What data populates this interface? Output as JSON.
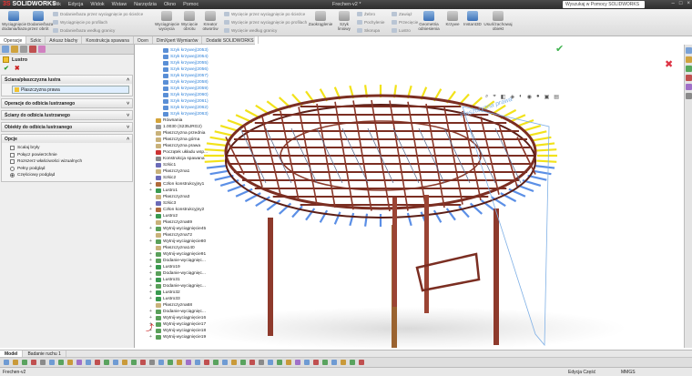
{
  "app": {
    "logo_prefix": "3S",
    "logo_name": "SOLIDWORKS",
    "menu": [
      "Plik",
      "Edycja",
      "Widok",
      "Wstaw",
      "Narzędzia",
      "Okno",
      "Pomoc"
    ],
    "document_title": "Frechen-v2 *",
    "search_placeholder": "Wyszukaj w Pomocy SOLIDWORKS"
  },
  "command_manager": {
    "extrude_boss": "Wyciągnięcie dodania/baza",
    "revolve_boss": "Dodanie/baza przez obrót",
    "sweep_boss": "Dodanie/baza przez wyciągnięcie po ścieżce",
    "loft_boss": "Wyciągnięcie po profilach",
    "boundary_boss": "Dodanie/baza według granicy",
    "extrude_cut": "Wyciągnięcie wycięcia",
    "revolve_cut": "Wycięcie obrotu",
    "hole_wizard": "Kreator otworów",
    "sweep_cut": "Wycięcie przez wyciągnięcie po ścieżce",
    "loft_cut": "Wycięcie przez wyciągnięcie po profilach",
    "boundary_cut": "Wycięcie według granicy",
    "fillet": "Zaokrąglenie",
    "linear_pattern": "Szyk liniowy",
    "rib": "Żebro",
    "draft": "Pochylenie",
    "shell": "Skorupa",
    "wrap": "Zawiąż",
    "intersect": "Przecięcie",
    "mirror": "Lustro",
    "ref_geometry": "Geometria odniesienia",
    "curves": "Krzywe",
    "instant3d": "Instant3D",
    "uncut": "Usuń/zachowaj obiekt"
  },
  "command_tabs": [
    "Operacje",
    "Szkic",
    "Arkusz blachy",
    "Konstrukcja spawana",
    "Ocen",
    "DimXpert Wymiarów",
    "Dodatki SOLIDWORKS"
  ],
  "property_manager": {
    "title": "Lustro",
    "group_face": {
      "title": "Ściana/płaszczyzna lustra",
      "value": "Płaszczyzna prawa"
    },
    "group_features": "Operacje do odbicia lustrzanego",
    "group_faces": "Ściany do odbicia lustrzanego",
    "group_bodies": "Obiekty do odbicia lustrzanego",
    "group_options": {
      "title": "Opcje",
      "merge": "Scalaj bryły",
      "knit": "Połącz powierzchnie",
      "propagate": "Rozszerz właściwości wizualnych",
      "full_preview": "Pełny podgląd",
      "partial_preview": "Częściowy podgląd"
    }
  },
  "feature_tree": {
    "items": [
      {
        "label": "Szyk krzywej(2053)",
        "type": "pattern"
      },
      {
        "label": "Szyk krzywej(2054)",
        "type": "pattern"
      },
      {
        "label": "Szyk krzywej(2055)",
        "type": "pattern"
      },
      {
        "label": "Szyk krzywej(2056)",
        "type": "pattern"
      },
      {
        "label": "Szyk krzywej(2057)",
        "type": "pattern"
      },
      {
        "label": "Szyk krzywej(2058)",
        "type": "pattern"
      },
      {
        "label": "Szyk krzywej(2059)",
        "type": "pattern"
      },
      {
        "label": "Szyk krzywej(2060)",
        "type": "pattern"
      },
      {
        "label": "Szyk krzywej(2061)",
        "type": "pattern"
      },
      {
        "label": "Szyk krzywej(2062)",
        "type": "pattern"
      },
      {
        "label": "Szyk krzywej(2063)",
        "type": "pattern"
      },
      {
        "label": "Równania",
        "type": "folder"
      },
      {
        "label": "1.0030 (S235JRG2)",
        "type": "material"
      },
      {
        "label": "Płaszczyzna przednia",
        "type": "plane"
      },
      {
        "label": "Płaszczyzna górna",
        "type": "plane"
      },
      {
        "label": "Płaszczyzna prawa",
        "type": "plane"
      },
      {
        "label": "Początek układu wsp...",
        "type": "origin"
      },
      {
        "label": "Konstrukcja spawana",
        "type": "weld"
      },
      {
        "label": "Szkic1",
        "type": "sketch"
      },
      {
        "label": "Płaszczyzna1",
        "type": "plane"
      },
      {
        "label": "Szkic2",
        "type": "sketch"
      },
      {
        "label": "Człon konstrukcyjny1",
        "type": "member"
      },
      {
        "label": "Lustro1",
        "type": "mirror"
      },
      {
        "label": "Płaszczyzna3",
        "type": "plane"
      },
      {
        "label": "Szkic3",
        "type": "sketch"
      },
      {
        "label": "Człon konstrukcyjny2",
        "type": "member"
      },
      {
        "label": "Lustro2",
        "type": "mirror"
      },
      {
        "label": "Płaszczyzna69",
        "type": "plane"
      },
      {
        "label": "Wytnij-wyciągnięcie45",
        "type": "cut"
      },
      {
        "label": "Płaszczyzna72",
        "type": "plane"
      },
      {
        "label": "Wytnij-wyciągnięcie80",
        "type": "cut"
      },
      {
        "label": "Płaszczyzna140",
        "type": "plane"
      },
      {
        "label": "Wytnij-wyciągnięcie91",
        "type": "cut"
      },
      {
        "label": "Dodanie-wyciągnięc...",
        "type": "boss"
      },
      {
        "label": "Lustro19",
        "type": "mirror"
      },
      {
        "label": "Dodanie-wyciągnięc...",
        "type": "boss"
      },
      {
        "label": "Lustro31",
        "type": "mirror"
      },
      {
        "label": "Dodanie-wyciągnięc...",
        "type": "boss"
      },
      {
        "label": "Lustro32",
        "type": "mirror"
      },
      {
        "label": "Lustro33",
        "type": "mirror"
      },
      {
        "label": "Płaszczyzna68",
        "type": "plane"
      },
      {
        "label": "Dodanie-wyciągnięc...",
        "type": "boss"
      },
      {
        "label": "Wytnij-wyciągnięcie16",
        "type": "cut"
      },
      {
        "label": "Wytnij-wyciągnięcie17",
        "type": "cut"
      },
      {
        "label": "Wytnij-wyciągnięcie18",
        "type": "cut"
      },
      {
        "label": "Wytnij-wyciągnięcie19",
        "type": "cut"
      }
    ]
  },
  "viewport": {
    "plane_label": "Płaszczyzna prawa"
  },
  "model_tabs": [
    "Model",
    "Badanie ruchu 1"
  ],
  "status": {
    "document": "Frechen-v2",
    "mode": "Edycja Część",
    "units": "MMGS"
  }
}
